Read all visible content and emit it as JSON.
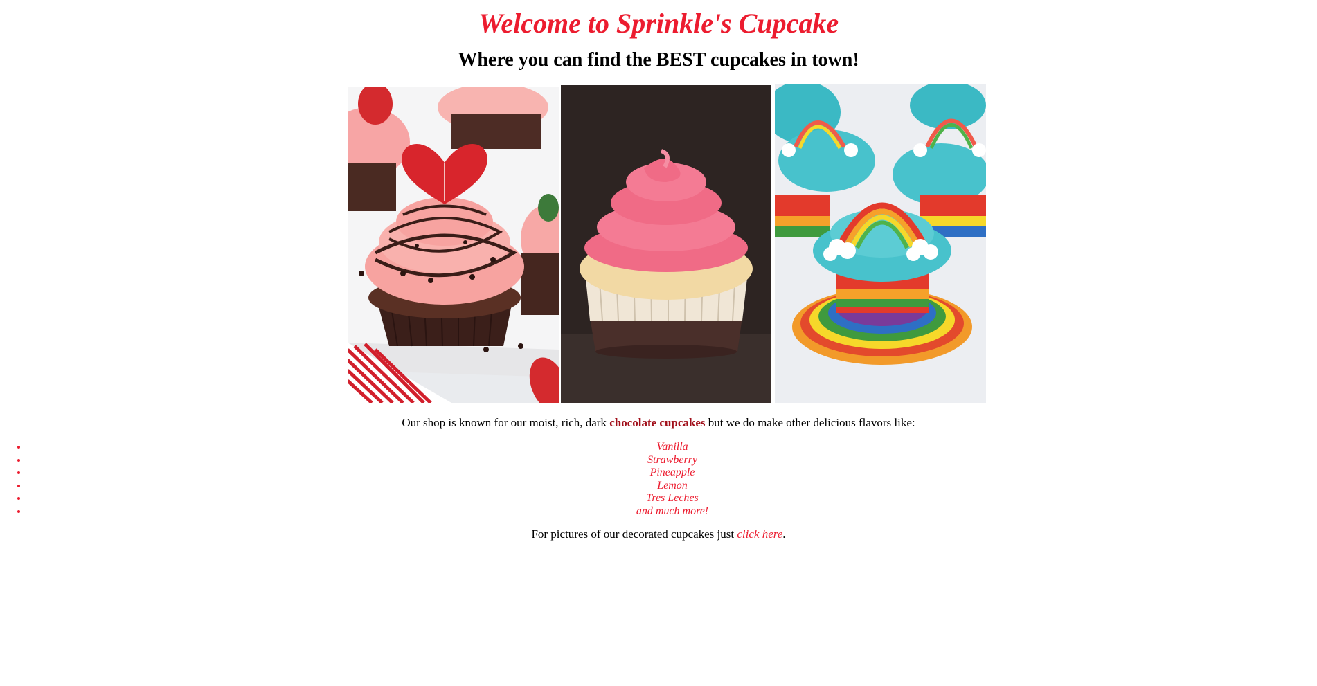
{
  "header": {
    "title": "Welcome to Sprinkle's Cupcake",
    "subtitle": "Where you can find the BEST cupcakes in town!"
  },
  "gallery": [
    {
      "icon": "strawberry-chocolate-cupcake-image"
    },
    {
      "icon": "pink-frosted-vanilla-cupcake-image"
    },
    {
      "icon": "rainbow-cupcake-image"
    }
  ],
  "intro": {
    "before": "Our shop is known for our moist, rich, dark ",
    "highlight": "chocolate cupcakes",
    "after": " but we do make other delicious flavors like:"
  },
  "flavors": [
    "Vanilla",
    "Strawberry",
    "Pineapple",
    "Lemon",
    "Tres Leches",
    "and much more!"
  ],
  "outro": {
    "before": "For pictures of our decorated cupcakes just",
    "link": " click here",
    "after": "."
  },
  "colors": {
    "accent": "#ec1c2f",
    "highlight": "#a10f1a",
    "text": "#000000",
    "background": "#ffffff"
  }
}
